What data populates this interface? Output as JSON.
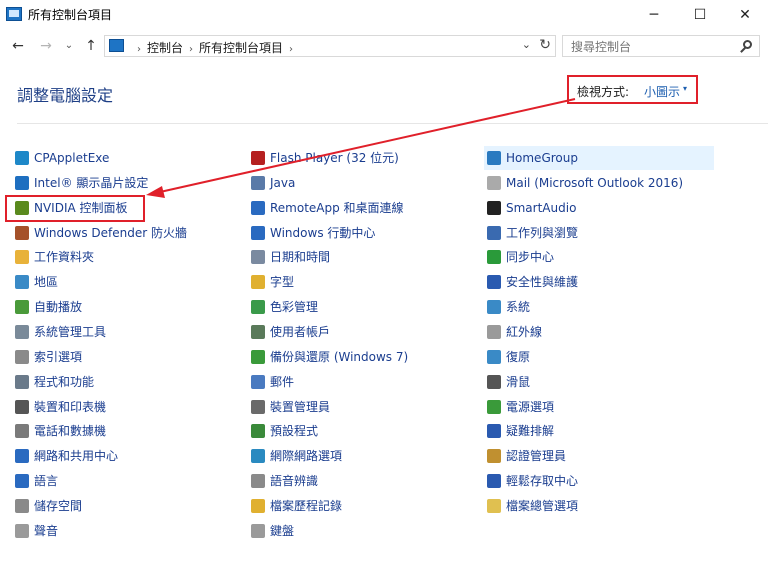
{
  "window": {
    "title": "所有控制台項目",
    "minimize": "─",
    "maximize": "☐",
    "close": "✕"
  },
  "nav": {
    "back": "←",
    "forward": "→",
    "recent": "⌄",
    "up": "↑",
    "breadcrumbs": [
      "控制台",
      "所有控制台項目"
    ],
    "breadcrumb_sep": "›",
    "address_dropdown": "⌄",
    "refresh": "↻",
    "search_placeholder": "搜尋控制台"
  },
  "header": {
    "title": "調整電腦設定",
    "view_label": "檢視方式:",
    "view_value": "小圖示",
    "view_arrow": "▾"
  },
  "columns": [
    [
      {
        "label": "CPAppletExe",
        "icon": "wifi-icon",
        "color": "#1e88c8"
      },
      {
        "label": "Intel® 顯示晶片設定",
        "icon": "intel-display-icon",
        "color": "#1e6fc0"
      },
      {
        "label": "NVIDIA 控制面板",
        "icon": "nvidia-icon",
        "color": "#5a8a1e"
      },
      {
        "label": "Windows Defender 防火牆",
        "icon": "firewall-icon",
        "color": "#a5512a"
      },
      {
        "label": "工作資料夾",
        "icon": "work-folders-icon",
        "color": "#e8b23a"
      },
      {
        "label": "地區",
        "icon": "region-icon",
        "color": "#3a8ac6"
      },
      {
        "label": "自動播放",
        "icon": "autoplay-icon",
        "color": "#4a9a3a"
      },
      {
        "label": "系統管理工具",
        "icon": "admin-tools-icon",
        "color": "#7a8a99"
      },
      {
        "label": "索引選項",
        "icon": "indexing-icon",
        "color": "#8a8a8a"
      },
      {
        "label": "程式和功能",
        "icon": "programs-icon",
        "color": "#6a7a8a"
      },
      {
        "label": "裝置和印表機",
        "icon": "devices-printers-icon",
        "color": "#555555"
      },
      {
        "label": "電話和數據機",
        "icon": "phone-modem-icon",
        "color": "#7a7a7a"
      },
      {
        "label": "網路和共用中心",
        "icon": "network-sharing-icon",
        "color": "#2a6ac0"
      },
      {
        "label": "語言",
        "icon": "language-icon",
        "color": "#2a6ac0"
      },
      {
        "label": "儲存空間",
        "icon": "storage-spaces-icon",
        "color": "#8a8a8a"
      },
      {
        "label": "聲音",
        "icon": "sound-icon",
        "color": "#9a9a9a"
      }
    ],
    [
      {
        "label": "Flash Player (32 位元)",
        "icon": "flash-icon",
        "color": "#b52020"
      },
      {
        "label": "Java",
        "icon": "java-icon",
        "color": "#5a7aa8"
      },
      {
        "label": "RemoteApp 和桌面連線",
        "icon": "remoteapp-icon",
        "color": "#2a6ac0"
      },
      {
        "label": "Windows 行動中心",
        "icon": "mobility-icon",
        "color": "#2a6ac0"
      },
      {
        "label": "日期和時間",
        "icon": "date-time-icon",
        "color": "#7a8aa0"
      },
      {
        "label": "字型",
        "icon": "fonts-icon",
        "color": "#e0b030"
      },
      {
        "label": "色彩管理",
        "icon": "color-management-icon",
        "color": "#3a9a4a"
      },
      {
        "label": "使用者帳戶",
        "icon": "user-accounts-icon",
        "color": "#5a7a5a"
      },
      {
        "label": "備份與還原 (Windows 7)",
        "icon": "backup-restore-icon",
        "color": "#3a9a3a"
      },
      {
        "label": "郵件",
        "icon": "mail-setup-icon",
        "color": "#4a7ac0"
      },
      {
        "label": "裝置管理員",
        "icon": "device-manager-icon",
        "color": "#6a6a6a"
      },
      {
        "label": "預設程式",
        "icon": "default-programs-icon",
        "color": "#3a8a3a"
      },
      {
        "label": "網際網路選項",
        "icon": "internet-options-icon",
        "color": "#2a8ac0"
      },
      {
        "label": "語音辨識",
        "icon": "speech-recognition-icon",
        "color": "#8a8a8a"
      },
      {
        "label": "檔案歷程記錄",
        "icon": "file-history-icon",
        "color": "#e0b030"
      },
      {
        "label": "鍵盤",
        "icon": "keyboard-icon",
        "color": "#9a9a9a"
      }
    ],
    [
      {
        "label": "HomeGroup",
        "icon": "homegroup-icon",
        "color": "#2a7ac0"
      },
      {
        "label": "Mail (Microsoft Outlook 2016)",
        "icon": "outlook-mail-icon",
        "color": "#aaaaaa"
      },
      {
        "label": "SmartAudio",
        "icon": "smartaudio-icon",
        "color": "#222222"
      },
      {
        "label": "工作列與瀏覽",
        "icon": "taskbar-icon",
        "color": "#3a6ab0"
      },
      {
        "label": "同步中心",
        "icon": "sync-center-icon",
        "color": "#2a9a3a"
      },
      {
        "label": "安全性與維護",
        "icon": "security-maintenance-icon",
        "color": "#2a5ab0"
      },
      {
        "label": "系統",
        "icon": "system-icon",
        "color": "#3a8ac6"
      },
      {
        "label": "紅外線",
        "icon": "infrared-icon",
        "color": "#9a9a9a"
      },
      {
        "label": "復原",
        "icon": "recovery-icon",
        "color": "#3a8ac6"
      },
      {
        "label": "滑鼠",
        "icon": "mouse-icon",
        "color": "#555555"
      },
      {
        "label": "電源選項",
        "icon": "power-options-icon",
        "color": "#3a9a3a"
      },
      {
        "label": "疑難排解",
        "icon": "troubleshooting-icon",
        "color": "#2a5ab0"
      },
      {
        "label": "認證管理員",
        "icon": "credential-manager-icon",
        "color": "#c09030"
      },
      {
        "label": "輕鬆存取中心",
        "icon": "ease-of-access-icon",
        "color": "#2a5ab0"
      },
      {
        "label": "檔案總管選項",
        "icon": "explorer-options-icon",
        "color": "#e0c050"
      }
    ]
  ],
  "annotation": {
    "box_color": "#e0202a",
    "arrow_color": "#e0202a"
  }
}
